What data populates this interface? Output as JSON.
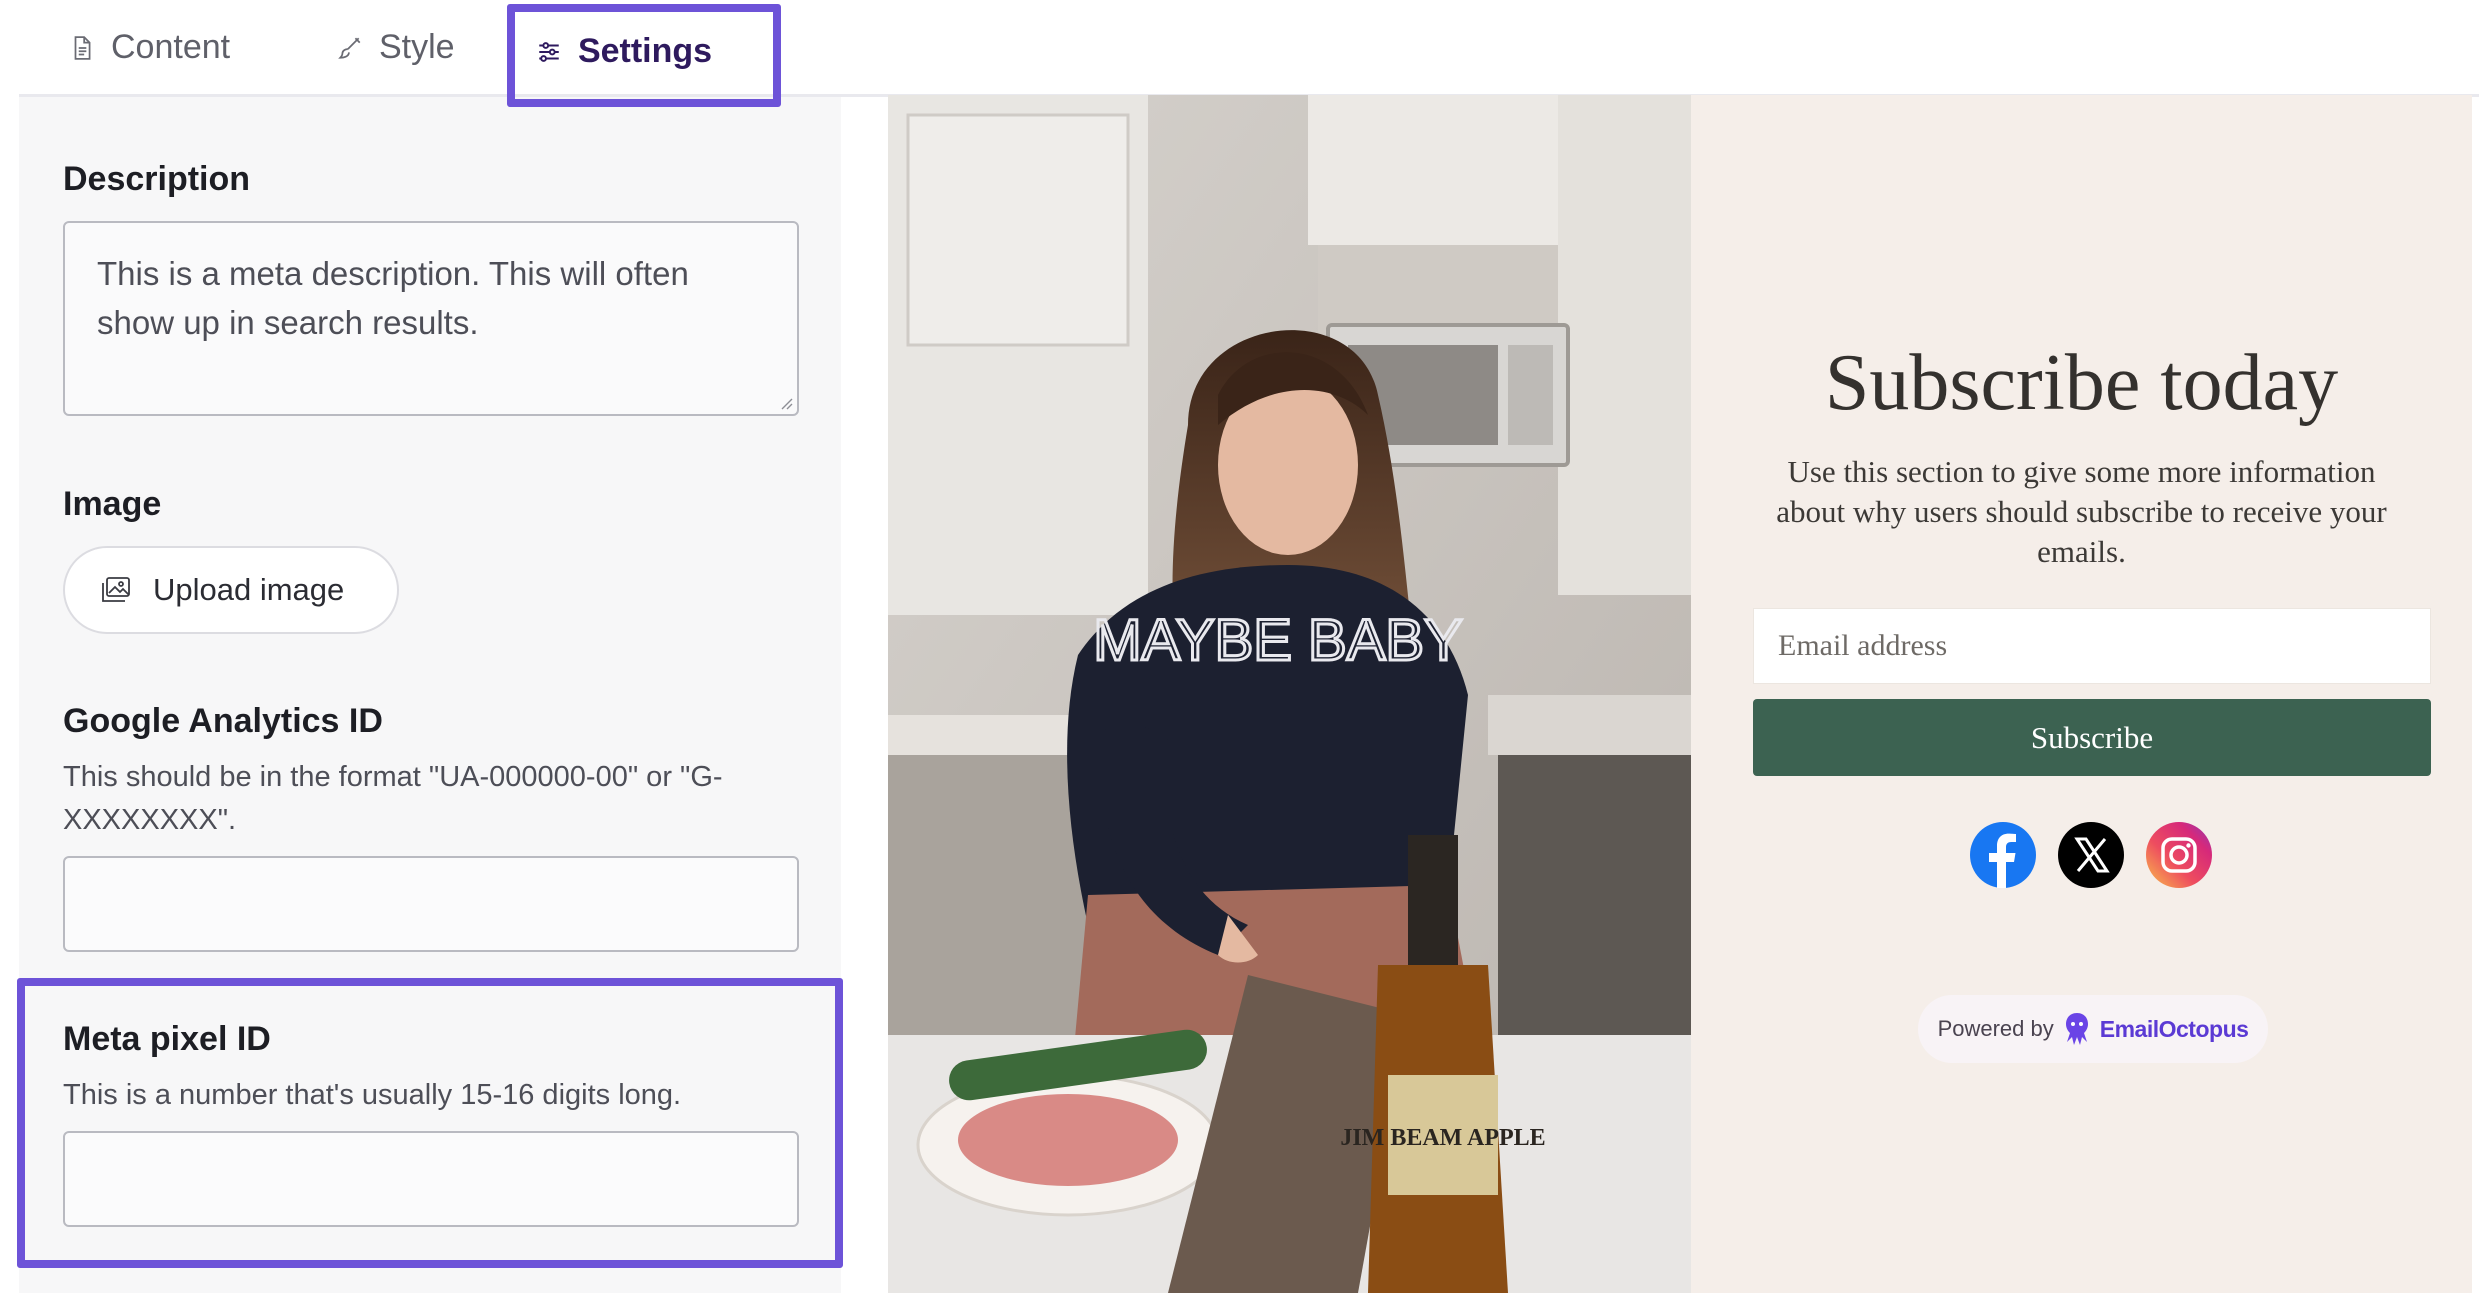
{
  "tabs": {
    "content": "Content",
    "style": "Style",
    "settings": "Settings"
  },
  "settings": {
    "description_label": "Description",
    "description_value": "This is a meta description. This will often show up in search results.",
    "image_label": "Image",
    "upload_button": "Upload image",
    "ga_label": "Google Analytics ID",
    "ga_help": "This should be in the format \"UA-000000-00\" or \"G-XXXXXXXX\".",
    "ga_value": "",
    "meta_label": "Meta pixel ID",
    "meta_help": "This is a number that's usually 15-16 digits long.",
    "meta_value": ""
  },
  "preview": {
    "title": "Subscribe today",
    "body": "Use this section to give some more information about why users should subscribe to receive your emails.",
    "email_placeholder": "Email address",
    "subscribe_button": "Subscribe",
    "sweater_text": "MAYBE BABY",
    "bottle_text": "JIM BEAM APPLE",
    "social": [
      "facebook-icon",
      "x-icon",
      "instagram-icon"
    ],
    "powered_by": "Powered by",
    "brand": "EmailOctopus"
  },
  "colors": {
    "accent": "#6d53d8",
    "button": "#3c6251",
    "preview_bg": "#f5eee9",
    "facebook": "#1877f2",
    "instagram": "#d6297a"
  }
}
